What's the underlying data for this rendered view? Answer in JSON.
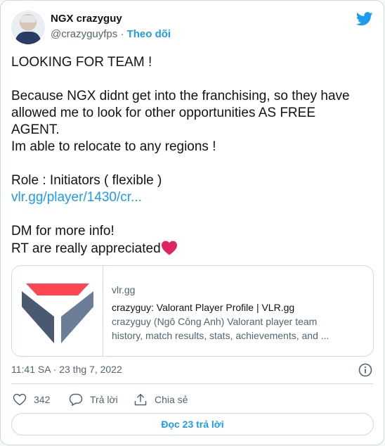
{
  "author": {
    "name": "NGX crazyguy",
    "handle": "@crazyguyfps",
    "separator": "·",
    "follow_label": "Theo dõi"
  },
  "tweet": {
    "lines": [
      "LOOKING FOR TEAM !",
      "",
      "Because NGX didnt get into the franchising, so they have allowed me to look for other opportunities AS FREE AGENT.",
      "Im able to relocate to any regions !",
      "",
      "Role : Initiators ( flexible )",
      "",
      "",
      "DM for more info!",
      "RT are really appreciated"
    ],
    "link_text": "vlr.gg/player/1430/cr..."
  },
  "card": {
    "domain": "vlr.gg",
    "title": "crazyguy: Valorant Player Profile | VLR.gg",
    "description_line1": "crazyguy (Ngô Công Anh) Valorant player team",
    "description_line2": "history, match results, stats, achievements, and ..."
  },
  "timestamp": "11:41 SA · 23 thg 7, 2022",
  "actions": {
    "likes": "342",
    "reply_label": "Trả lời",
    "share_label": "Chia sẻ"
  },
  "read_replies_label": "Đọc 23 trả lời",
  "colors": {
    "accent": "#1d9bf0",
    "heart": "#e0245e",
    "logo_red": "#ff4655"
  },
  "icons": [
    "twitter-bird-icon",
    "heart-emoji-icon",
    "vlr-logo",
    "info-icon",
    "like-icon",
    "reply-icon",
    "share-icon"
  ]
}
